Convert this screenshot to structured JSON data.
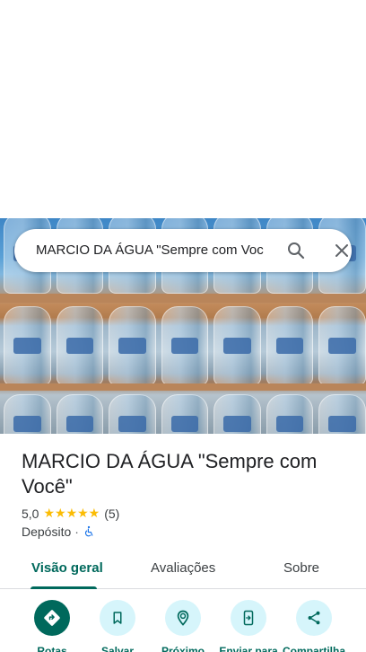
{
  "search": {
    "query": "MARCIO DA ÁGUA \"Sempre com Voc"
  },
  "place": {
    "name": "MARCIO DA ÁGUA \"Sempre com Você\"",
    "rating": "5,0",
    "stars": "★★★★★",
    "review_count": "(5)",
    "category": "Depósito",
    "separator": "·"
  },
  "tabs": [
    {
      "label": "Visão geral",
      "active": true
    },
    {
      "label": "Avaliações",
      "active": false
    },
    {
      "label": "Sobre",
      "active": false
    }
  ],
  "actions": [
    {
      "label": "Rotas",
      "icon": "directions-icon"
    },
    {
      "label": "Salvar",
      "icon": "bookmark-icon"
    },
    {
      "label": "Próximo",
      "icon": "nearby-icon"
    },
    {
      "label": "Enviar para",
      "icon": "send-to-phone-icon"
    },
    {
      "label": "Compartilha",
      "icon": "share-icon"
    }
  ],
  "colors": {
    "accent": "#00695c",
    "action_bg": "#d6f5fb",
    "star": "#fbbc04"
  }
}
